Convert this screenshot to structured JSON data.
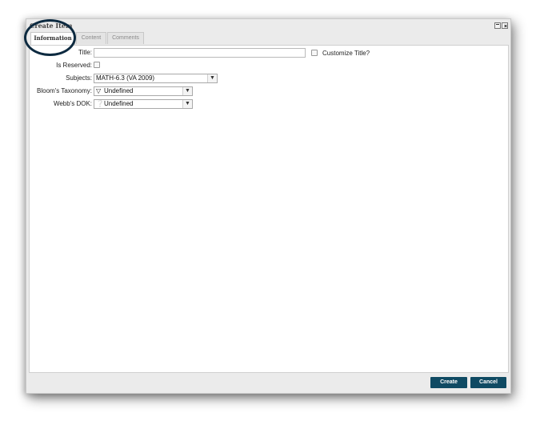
{
  "dialog": {
    "title": "Create Item"
  },
  "tabs": [
    {
      "label": "Information",
      "active": true
    },
    {
      "label": "Content",
      "active": false
    },
    {
      "label": "Comments",
      "active": false
    }
  ],
  "form": {
    "title_label": "Title:",
    "title_value": "",
    "customize_title_label": "Customize Title?",
    "customize_title_checked": false,
    "reserved_label": "Is Reserved:",
    "reserved_checked": false,
    "subjects_label": "Subjects:",
    "subjects_value": "MATH-6.3 (VA 2009)",
    "bloom_label": "Bloom's Taxonomy:",
    "bloom_value": "Undefined",
    "bloom_icon": "pyramid-icon",
    "webb_label": "Webb's DOK:",
    "webb_value": "Undefined",
    "webb_icon": "question-circle-icon"
  },
  "footer": {
    "create_label": "Create",
    "cancel_label": "Cancel"
  },
  "colors": {
    "button_bg": "#0f4a63",
    "annotation_ring": "#0d2a40"
  }
}
